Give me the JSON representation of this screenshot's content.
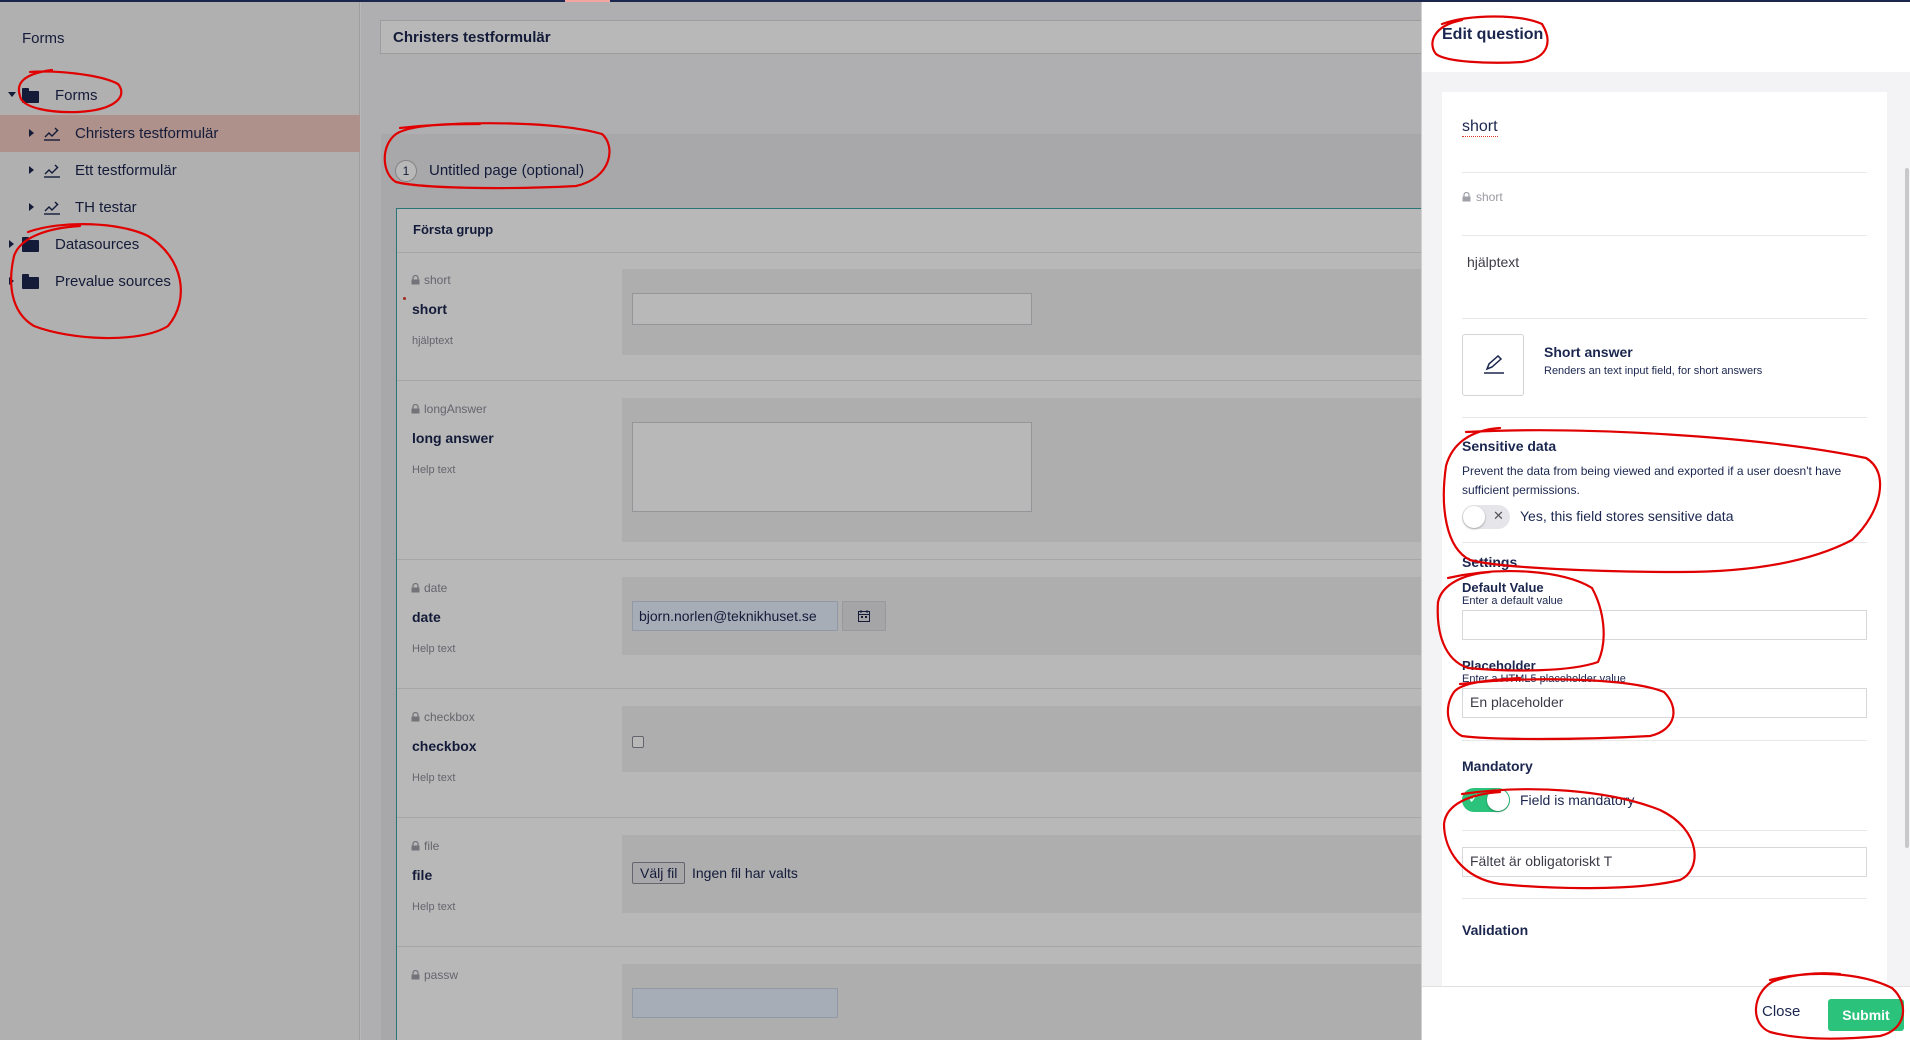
{
  "sidebar": {
    "title": "Forms",
    "tree": [
      {
        "label": "Forms",
        "icon": "folder-icon",
        "expanded": true
      },
      {
        "label": "Christers testformulär",
        "icon": "form-icon",
        "active": true
      },
      {
        "label": "Ett testformulär",
        "icon": "form-icon"
      },
      {
        "label": "TH testar",
        "icon": "form-icon"
      },
      {
        "label": "Datasources",
        "icon": "folder-icon"
      },
      {
        "label": "Prevalue sources",
        "icon": "folder-icon"
      }
    ]
  },
  "main": {
    "form_title": "Christers testformulär",
    "page": {
      "number": "1",
      "title": "Untitled page (optional)"
    },
    "group_title": "Första grupp",
    "questions": [
      {
        "alias": "short",
        "label": "short",
        "help": "hjälptext",
        "type": "text"
      },
      {
        "alias": "longAnswer",
        "label": "long answer",
        "help": "Help text",
        "type": "textarea"
      },
      {
        "alias": "date",
        "label": "date",
        "help": "Help text",
        "type": "date",
        "value": "bjorn.norlen@teknikhuset.se"
      },
      {
        "alias": "checkbox",
        "label": "checkbox",
        "help": "Help text",
        "type": "checkbox"
      },
      {
        "alias": "file",
        "label": "file",
        "help": "Help text",
        "type": "file",
        "button": "Välj fil",
        "status": "Ingen fil har valts"
      },
      {
        "alias": "passw",
        "label": "",
        "help": "",
        "type": "password"
      }
    ]
  },
  "panel": {
    "title": "Edit question",
    "question_name": "short",
    "alias": "short",
    "help_text": "hjälptext",
    "field_type": {
      "name": "Short answer",
      "description": "Renders an text input field, for short answers",
      "icon": "edit-icon"
    },
    "sensitive": {
      "heading": "Sensitive data",
      "description": "Prevent the data from being viewed and exported if a user doesn't have sufficient permissions.",
      "toggle_label": "Yes, this field stores sensitive data",
      "enabled": false
    },
    "settings": {
      "heading": "Settings",
      "default_value": {
        "label": "Default Value",
        "description": "Enter a default value",
        "value": ""
      },
      "placeholder": {
        "label": "Placeholder",
        "description": "Enter a HTML5 placeholder value",
        "value": "En placeholder"
      }
    },
    "mandatory": {
      "heading": "Mandatory",
      "toggle_label": "Field is mandatory",
      "enabled": true,
      "message": "Fältet är obligatoriskt T"
    },
    "validation": {
      "heading": "Validation"
    },
    "buttons": {
      "close": "Close",
      "submit": "Submit"
    }
  },
  "colors": {
    "navy": "#1b264f",
    "active_item": "#f2c9c0",
    "submit_green": "#2bc37c",
    "annotation_red": "#e00000",
    "group_border": "#3aa1a6"
  }
}
